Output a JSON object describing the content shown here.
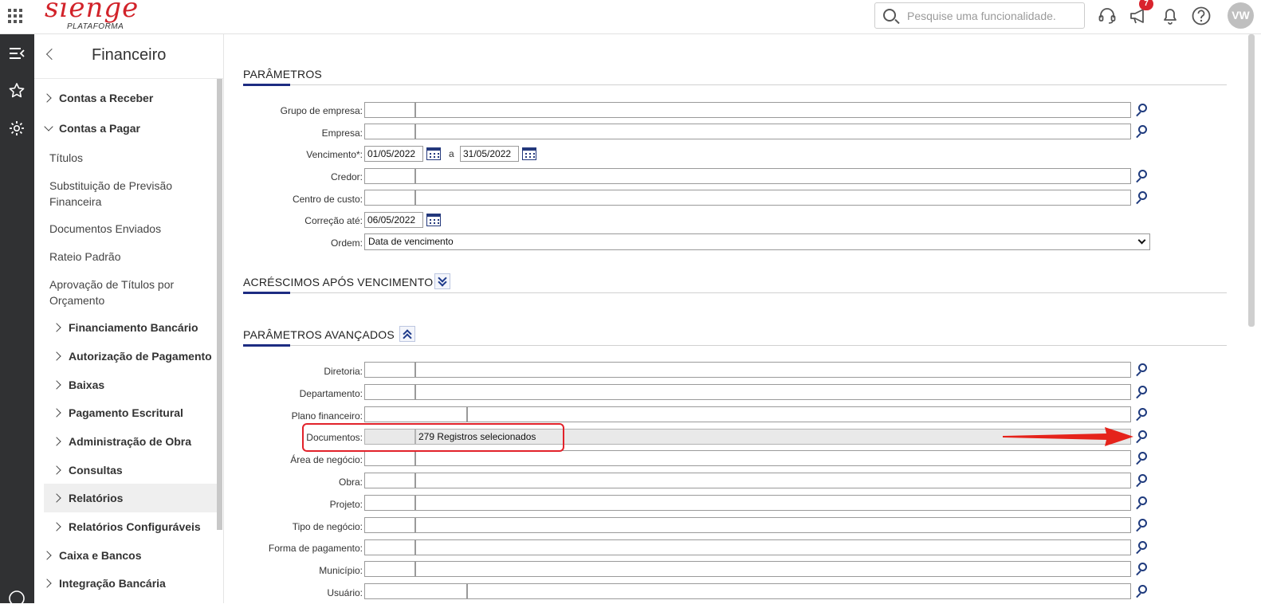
{
  "topbar": {
    "logo_text": "sienge",
    "logo_subtitle": "PLATAFORMA",
    "search_placeholder": "Pesquise uma funcionalidade.",
    "notifications_count": "7",
    "avatar_initials": "VW"
  },
  "sidebar": {
    "title": "Financeiro",
    "items": [
      {
        "label": "Contas a Receber"
      },
      {
        "label": "Contas a Pagar"
      },
      {
        "label": "Títulos"
      },
      {
        "label": "Substituição de Previsão Financeira"
      },
      {
        "label": "Documentos Enviados"
      },
      {
        "label": "Rateio Padrão"
      },
      {
        "label": "Aprovação de Títulos por Orçamento"
      },
      {
        "label": "Financiamento Bancário"
      },
      {
        "label": "Autorização de Pagamento"
      },
      {
        "label": "Baixas"
      },
      {
        "label": "Pagamento Escritural"
      },
      {
        "label": "Administração de Obra"
      },
      {
        "label": "Consultas"
      },
      {
        "label": "Relatórios"
      },
      {
        "label": "Relatórios Configuráveis"
      },
      {
        "label": "Caixa e Bancos"
      },
      {
        "label": "Integração Bancária"
      }
    ]
  },
  "sections": {
    "parametros": "PARÂMETROS",
    "acrescimos": "ACRÉSCIMOS APÓS VENCIMENTO",
    "avancados": "PARÂMETROS AVANÇADOS"
  },
  "params": {
    "grupo_empresa": "Grupo de empresa:",
    "empresa": "Empresa:",
    "vencimento": "Vencimento*:",
    "vencimento_de": "01/05/2022",
    "vencimento_sep": "a",
    "vencimento_ate": "31/05/2022",
    "credor": "Credor:",
    "centro_custo": "Centro de custo:",
    "correcao_ate": "Correção até:",
    "correcao_value": "06/05/2022",
    "ordem": "Ordem:",
    "ordem_value": "Data de vencimento"
  },
  "advanced": {
    "diretoria": "Diretoria:",
    "departamento": "Departamento:",
    "plano_financeiro": "Plano financeiro:",
    "documentos": "Documentos:",
    "documentos_value": "279 Registros selecionados",
    "area_negocio": "Área de negócio:",
    "obra": "Obra:",
    "projeto": "Projeto:",
    "tipo_negocio": "Tipo de negócio:",
    "forma_pagamento": "Forma de pagamento:",
    "municipio": "Município:",
    "usuario": "Usuário:"
  },
  "colors": {
    "brand": "#d2232a",
    "accent": "#1d2c82",
    "rail": "#303133",
    "highlight": "#e2222a"
  }
}
